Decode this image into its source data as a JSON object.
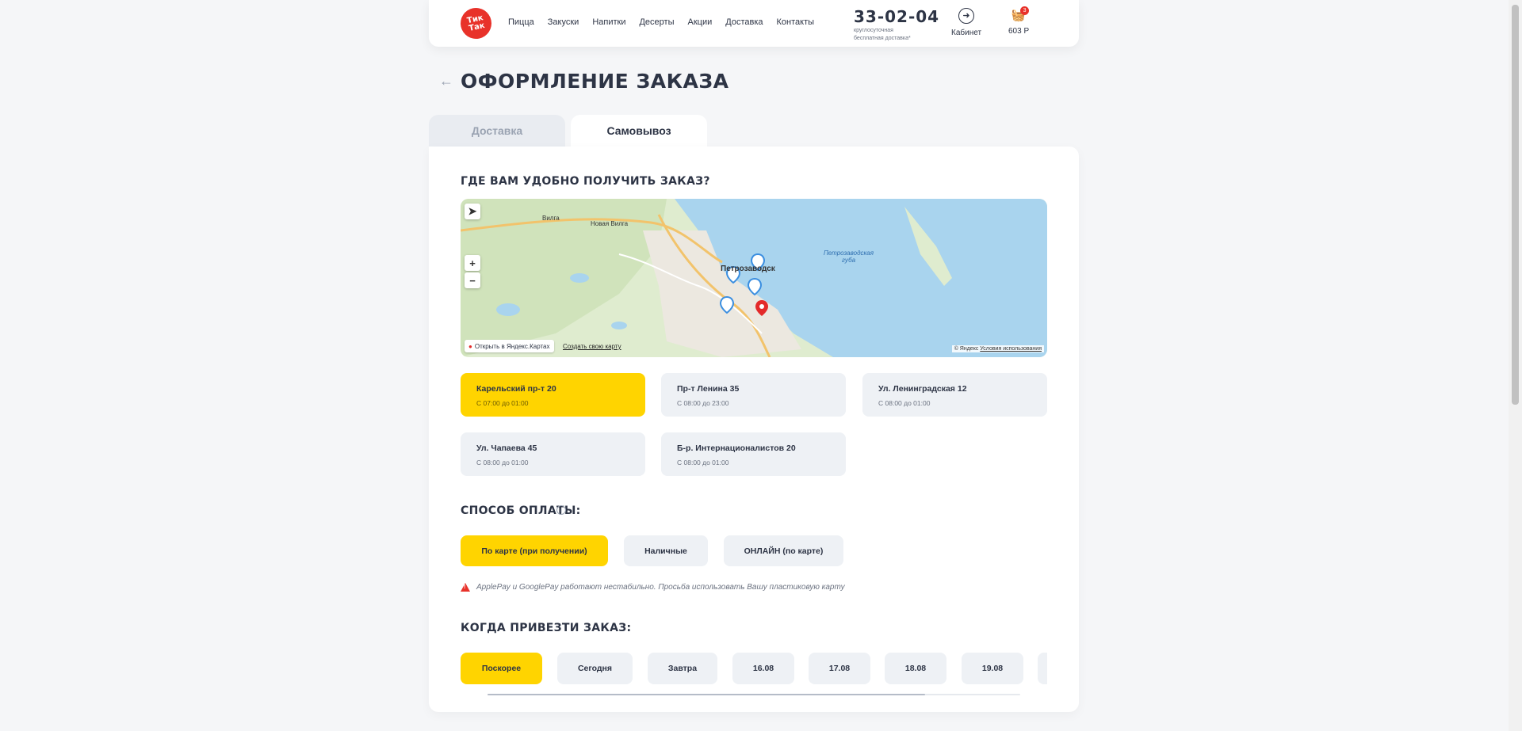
{
  "header": {
    "logo_text": "Тик Так",
    "nav": [
      "Пицца",
      "Закуски",
      "Напитки",
      "Десерты",
      "Акции",
      "Доставка",
      "Контакты"
    ],
    "phone": "33-02-04",
    "phone_sub1": "круглосуточная",
    "phone_sub2": "бесплатная доставка*",
    "cabinet_label": "Кабинет",
    "cart_price": "603 Р",
    "cart_count": "3"
  },
  "page": {
    "title": "ОФОРМЛЕНИЕ ЗАКАЗА",
    "tabs": [
      {
        "label": "Доставка"
      },
      {
        "label": "Самовывоз"
      }
    ]
  },
  "pickup": {
    "title": "ГДЕ ВАМ УДОБНО ПОЛУЧИТЬ ЗАКАЗ?",
    "map": {
      "city_label": "Петрозаводск",
      "bay_label_1": "Петрозаводская",
      "bay_label_2": "губа",
      "place_1": "Вилга",
      "place_2": "Новая Вилга",
      "open_label": "Открыть в Яндекс.Картах",
      "create_label": "Создать свою карту",
      "copyright": "© Яндекс",
      "terms": "Условия использования",
      "colors": {
        "water": "#a9d4ee",
        "land": "#dfeccf",
        "forest": "#c9e0b2",
        "city": "#ece8e0",
        "road": "#f2c36b",
        "pin_blue": "#3a8ee0",
        "pin_red": "#e32a2a"
      }
    },
    "locations": [
      {
        "name": "Карельский пр-т 20",
        "hours": "С 07:00 до 01:00",
        "selected": true
      },
      {
        "name": "Пр-т Ленина 35",
        "hours": "С 08:00 до 23:00",
        "selected": false
      },
      {
        "name": "Ул. Ленинградская 12",
        "hours": "С 08:00 до 01:00",
        "selected": false
      },
      {
        "name": "Ул. Чапаева 45",
        "hours": "С 08:00 до 01:00",
        "selected": false
      },
      {
        "name": "Б-р. Интернационалистов 20",
        "hours": "С 08:00 до 01:00",
        "selected": false
      }
    ]
  },
  "payment": {
    "title": "СПОСОБ ОПЛАТЫ:",
    "options": [
      {
        "label": "По карте (при получении)",
        "selected": true
      },
      {
        "label": "Наличные",
        "selected": false
      },
      {
        "label": "ОНЛАЙН (по карте)",
        "selected": false
      }
    ],
    "warning": "ApplePay и GooglePay работают нестабильно. Просьба использовать Вашу пластиковую карту"
  },
  "time": {
    "title": "КОГДА ПРИВЕЗТИ ЗАКАЗ:",
    "options": [
      {
        "label": "Поскорее",
        "selected": true
      },
      {
        "label": "Сегодня",
        "selected": false
      },
      {
        "label": "Завтра",
        "selected": false
      },
      {
        "label": "16.08",
        "selected": false
      },
      {
        "label": "17.08",
        "selected": false
      },
      {
        "label": "18.08",
        "selected": false
      },
      {
        "label": "19.08",
        "selected": false
      },
      {
        "label": "",
        "selected": false
      }
    ]
  },
  "colors": {
    "accent": "#ffd400",
    "brand_red": "#e8322a",
    "text": "#2d3445"
  }
}
